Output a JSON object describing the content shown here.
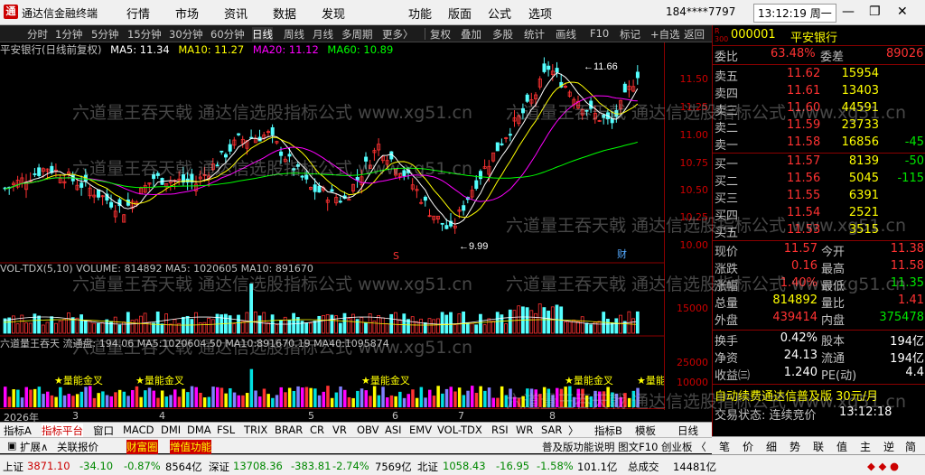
{
  "app": {
    "title": "通达信金融终端",
    "menus": [
      "行情",
      "市场",
      "资讯",
      "数据",
      "发现",
      "功能",
      "版面",
      "公式",
      "选项"
    ],
    "user_id": "184****7797",
    "clock": "13:12:19 周一"
  },
  "toolbar": {
    "items": [
      "分时",
      "1分钟",
      "5分钟",
      "15分钟",
      "30分钟",
      "60分钟",
      "日线",
      "周线",
      "月线",
      "多周期",
      "更多〉",
      "复权",
      "叠加",
      "多股",
      "统计",
      "画线",
      "F10",
      "标记",
      "+自选",
      "返回"
    ],
    "active": "日线"
  },
  "chart": {
    "title": "平安银行(日线前复权)",
    "ma": [
      {
        "label": "MA5: 11.34",
        "color": "#ffffff"
      },
      {
        "label": "MA10: 11.27",
        "color": "#ffff00"
      },
      {
        "label": "MA20: 11.12",
        "color": "#ff00ff"
      },
      {
        "label": "MA60: 10.89",
        "color": "#00ff00"
      }
    ],
    "yaxis": [
      "11.50",
      "11.25",
      "11.00",
      "10.75",
      "10.50",
      "10.25",
      "10.00"
    ],
    "high_label": "11.66",
    "low_label": "9.99",
    "marker_s": "S",
    "marker_cai": "财"
  },
  "volume": {
    "header": "VOL-TDX(5,10) VOLUME: 814892 MA5: 1020605 MA10: 891670",
    "yaxis": [
      "15000",
      "5000"
    ],
    "unit": "X100"
  },
  "liu": {
    "header": "六道量王吞天 流通盘: 194.06 MA5:1020604.50 MA10:891670.19 MA40:1095874",
    "yaxis": [
      "25000",
      "10000"
    ],
    "signals": [
      "量能金叉",
      "量能金叉",
      "量能金叉",
      "量能金叉",
      "量能"
    ]
  },
  "dates": [
    "2026年",
    "3",
    "4",
    "5",
    "6",
    "7",
    "8"
  ],
  "tabs1": {
    "items": [
      "指标A",
      "指标平台",
      "窗口",
      "MACD",
      "DMI",
      "DMA",
      "FSL",
      "TRIX",
      "BRAR",
      "CR",
      "VR",
      "OBV",
      "ASI",
      "EMV",
      "VOL-TDX",
      "RSI",
      "WR",
      "SAR",
      "〉",
      "指标B",
      "模板"
    ],
    "right": "日线"
  },
  "tabs2": {
    "items": [
      "扩展∧",
      "关联报价",
      "财富圈",
      "增值功能"
    ],
    "right": "普及版功能说明 图文F10 创业板 〈"
  },
  "stock": {
    "code": "000001",
    "name": "平安银行",
    "wb_label": "委比",
    "wb": "63.48%",
    "wc_label": "委差",
    "wc": "89026",
    "asks": [
      {
        "label": "卖五",
        "price": "11.62",
        "vol": "15954",
        "chg": ""
      },
      {
        "label": "卖四",
        "price": "11.61",
        "vol": "13403",
        "chg": ""
      },
      {
        "label": "卖三",
        "price": "11.60",
        "vol": "44591",
        "chg": ""
      },
      {
        "label": "卖二",
        "price": "11.59",
        "vol": "23733",
        "chg": ""
      },
      {
        "label": "卖一",
        "price": "11.58",
        "vol": "16856",
        "chg": "-45"
      }
    ],
    "bids": [
      {
        "label": "买一",
        "price": "11.57",
        "vol": "8139",
        "chg": "-50"
      },
      {
        "label": "买二",
        "price": "11.56",
        "vol": "5045",
        "chg": "-115"
      },
      {
        "label": "买三",
        "price": "11.55",
        "vol": "6391",
        "chg": ""
      },
      {
        "label": "买四",
        "price": "11.54",
        "vol": "2521",
        "chg": ""
      },
      {
        "label": "买五",
        "price": "11.53",
        "vol": "3515",
        "chg": ""
      }
    ],
    "quote": [
      [
        "现价",
        "11.57",
        "今开",
        "11.38"
      ],
      [
        "涨跌",
        "0.16",
        "最高",
        "11.58"
      ],
      [
        "涨幅",
        "1.40%",
        "最低",
        "11.35"
      ],
      [
        "总量",
        "814892",
        "量比",
        "1.41"
      ],
      [
        "外盘",
        "439414",
        "内盘",
        "375478"
      ]
    ],
    "stats": [
      [
        "换手",
        "0.42%",
        "股本",
        "194亿"
      ],
      [
        "净资",
        "24.13",
        "流通",
        "194亿"
      ],
      [
        "收益㈢",
        "1.240",
        "PE(动)",
        "4.4"
      ]
    ],
    "notice": "自动续费通达信普及版 30元/月",
    "trade_label": "交易状态: 连续竞价",
    "trade_time": "13:12:18"
  },
  "sidebtns": [
    "笔",
    "价",
    "细",
    "势",
    "联",
    "值",
    "主",
    "逆",
    "简"
  ],
  "status": {
    "items": [
      "上证",
      "3871.10",
      "-34.10",
      "-0.87%",
      "8564亿",
      "深证",
      "13708.36",
      "-383.81",
      "-2.74%",
      "7569亿",
      "北证",
      "1058.43",
      "-16.95",
      "-1.58%",
      "101.1亿",
      "总成交",
      "14481亿"
    ]
  },
  "watermark": "六道量王吞天戟 通达信选股指标公式 www.xg51.cn",
  "colors": {
    "up": "#ff3232",
    "down": "#54ffff",
    "ma5": "#ffffff",
    "ma10": "#ffff00",
    "ma20": "#ff00ff",
    "ma60": "#00ff00"
  }
}
